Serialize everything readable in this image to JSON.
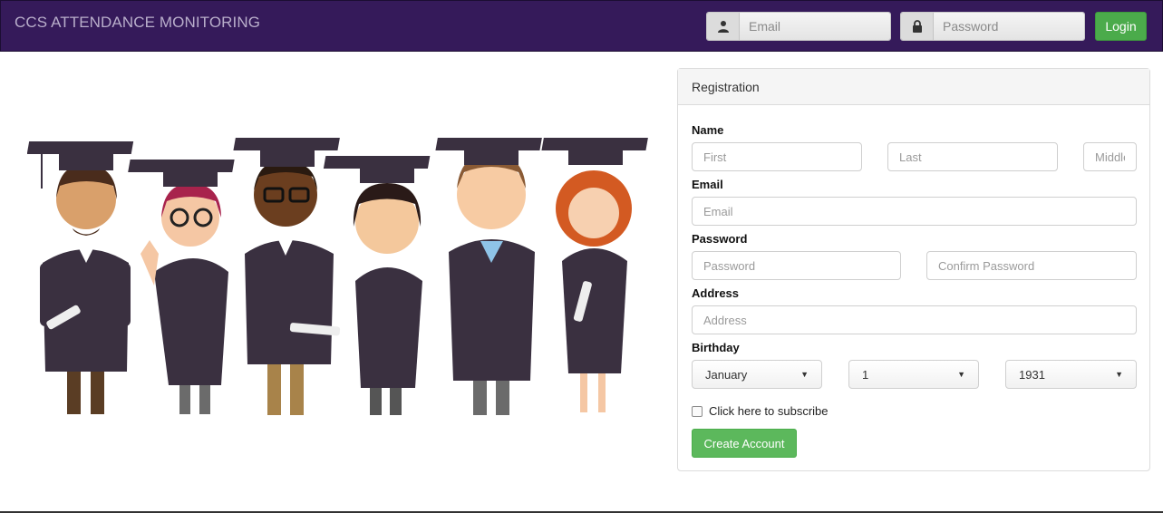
{
  "navbar": {
    "brand": "CCS ATTENDANCE MONITORING",
    "email_placeholder": "Email",
    "password_placeholder": "Password",
    "login_label": "Login",
    "email_icon": "user-icon",
    "password_icon": "lock-icon",
    "background_color": "#351a5a",
    "login_color": "#4bab4b"
  },
  "illustration": {
    "description_icon": "graduates-illustration"
  },
  "registration": {
    "heading": "Registration",
    "name_label": "Name",
    "first_placeholder": "First",
    "last_placeholder": "Last",
    "middle_placeholder": "Middle",
    "email_label": "Email",
    "email_placeholder": "Email",
    "password_label": "Password",
    "password_placeholder": "Password",
    "confirm_placeholder": "Confirm Password",
    "address_label": "Address",
    "address_placeholder": "Address",
    "birthday_label": "Birthday",
    "birthday_month": "January",
    "birthday_day": "1",
    "birthday_year": "1931",
    "subscribe_label": "Click here to subscribe",
    "create_label": "Create Account",
    "create_color": "#5cb85c"
  }
}
